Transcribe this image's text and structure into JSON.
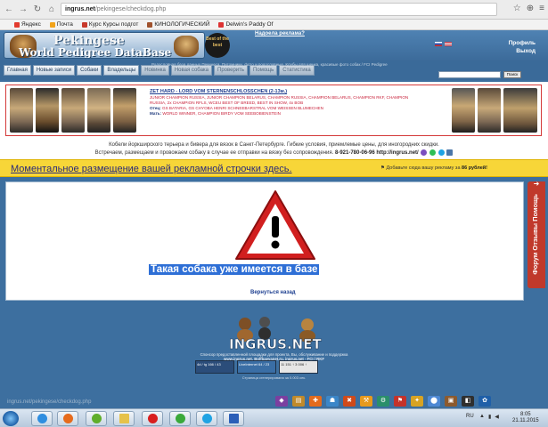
{
  "browser": {
    "url_host": "ingrus.net",
    "url_path": "/pekingese/checkdog.php",
    "bookmarks": [
      "Яндекс",
      "Почта",
      "Курс Курсы подгот",
      "КИНОЛОГИЧЕСКИЙ",
      "Delwin's Paddy Of"
    ],
    "status_url": "ingrus.net/pekingese/checkdog.php"
  },
  "header": {
    "logo_line1": "Pekingese",
    "logo_line2": "World Pedigree DataBase",
    "badge": "Best of the best",
    "ad_link": "Надоела реклама?",
    "sub_text": "Родословная база данных Пекинеса. Питомники, фото и родословные. Клубы для щенка, красивые фото собак / FCI Pedigree",
    "profile": "Профиль",
    "exit": "Выход"
  },
  "nav": {
    "items": [
      "Главная",
      "Новые записи",
      "Собаки",
      "Владельцы",
      "Новинка",
      "Новая собака",
      "Проверить",
      "Помощь",
      "Статистика"
    ],
    "search_placeholder": "",
    "search_button": "Поиск"
  },
  "banner": {
    "title": "ZET HARD - LORD VOM STERNENSCHLOSSCHEN (2-13м.)",
    "line1": "JUNIOR CHAMPION RUSSIA, JUNIOR CHAMPION BELARUS, CHAMPION RUSSIA, CHAMPION BELARUS, CHAMPION RKF, CHAMPION",
    "line2": "RUSSIA, 2x CHAMPION RFLS, WCEU BEST OF BREED, BEST IN SHOW, 4x BOB",
    "line3_label": "Отец:",
    "line3": "GS BATARIA, GS CHYOBA HENRI SCHNEEBARSTRAL VOM WEISSEN BLUMECHEN",
    "line4_label": "Мать:",
    "line4": "WORLD WINNER, CHAMPION BIRDY VOM SEEBOBIENSTEIN"
  },
  "info": {
    "line1": "Кобели йоркширского терьера и бивера для вязок в Санкт-Петербурге. Гибкие условия, приемлемые цены, для иногородних скидки.",
    "line2": "Встречаем, размещаем и провожаем собаку в случае ее отправки на вязку без сопровождения.",
    "phone": "8-921-780-06-96",
    "site": "http://ingrus.net/"
  },
  "ad_bar": {
    "link_text": "Моментальное размещение вашей рекламной строчки здесь.",
    "right_text": "Добавьте сюда вашу рекламу за",
    "price": "86 рублей",
    "exclamation": "!"
  },
  "main": {
    "error_message": "Такая собака уже имеется в базе",
    "back_link": "Вернуться назад"
  },
  "side_tab": {
    "text": "Форум Отзывы Помощь"
  },
  "footer": {
    "logo_text": "INGRUS.NET",
    "text1": "Спонсор предоставленной площадки для проекта, Вы, обслуживание и поддержка",
    "text2": "www.ingrus.net, Bolfbaevanet.ru, ingrus.net - FCI / RKF",
    "counters": [
      "4d / tg 166 / 43",
      "LiveInternet 64 / 23",
      "11 151 ↑ 3 006 ↑"
    ],
    "copyright": "Страница сгенерирована за 0.003 сек."
  },
  "taskbar": {
    "lang": "RU",
    "time": "8:05",
    "date": "21.11.2015"
  }
}
